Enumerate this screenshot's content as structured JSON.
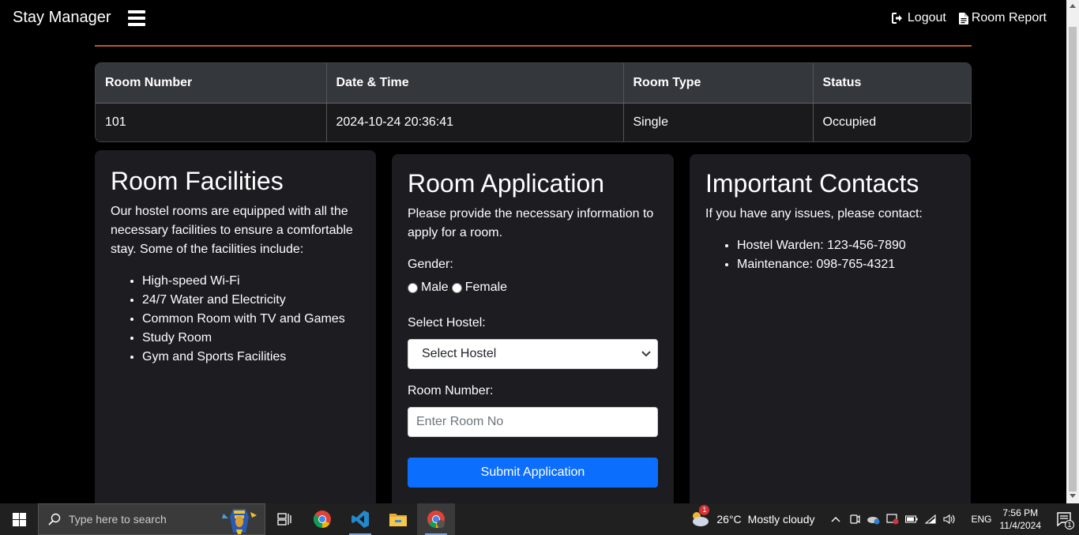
{
  "nav": {
    "brand": "Stay Manager",
    "logout_label": "Logout",
    "room_report_label": "Room Report"
  },
  "table": {
    "headers": [
      "Room Number",
      "Date & Time",
      "Room Type",
      "Status"
    ],
    "rows": [
      [
        "101",
        "2024-10-24 20:36:41",
        "Single",
        "Occupied"
      ]
    ]
  },
  "facilities": {
    "title": "Room Facilities",
    "intro": "Our hostel rooms are equipped with all the necessary facilities to ensure a comfortable stay. Some of the facilities include:",
    "items": [
      "High-speed Wi-Fi",
      "24/7 Water and Electricity",
      "Common Room with TV and Games",
      "Study Room",
      "Gym and Sports Facilities"
    ]
  },
  "application": {
    "title": "Room Application",
    "intro": "Please provide the necessary information to apply for a room.",
    "gender_label": "Gender:",
    "gender_options": [
      "Male",
      "Female"
    ],
    "hostel_label": "Select Hostel:",
    "hostel_selected": "Select Hostel",
    "room_label": "Room Number:",
    "room_placeholder": "Enter Room No",
    "submit_label": "Submit Application"
  },
  "contacts": {
    "title": "Important Contacts",
    "intro": "If you have any issues, please contact:",
    "items": [
      "Hostel Warden: 123-456-7890",
      "Maintenance: 098-765-4321"
    ]
  },
  "taskbar": {
    "search_placeholder": "Type here to search",
    "weather_temp": "26°C",
    "weather_desc": "Mostly cloudy",
    "weather_badge": "1",
    "language": "ENG",
    "time": "7:56 PM",
    "date": "11/4/2024",
    "notification_count": "1"
  },
  "colors": {
    "accent_divider": "#b65a3a",
    "primary_button": "#0b6efd",
    "card_bg": "#1c1c21"
  }
}
